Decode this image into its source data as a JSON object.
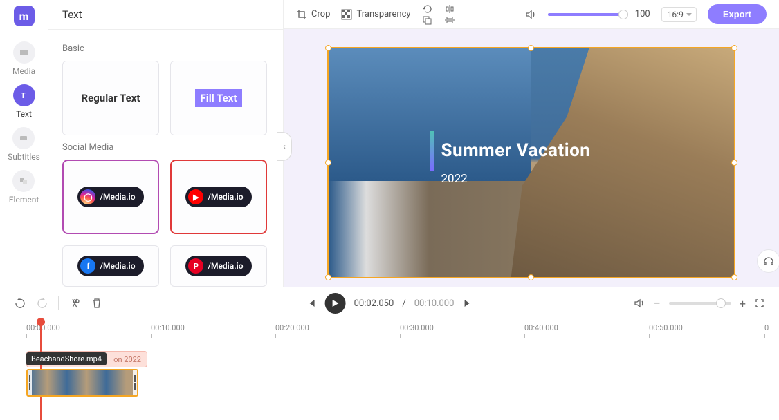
{
  "rail": {
    "items": [
      {
        "label": "Media"
      },
      {
        "label": "Text"
      },
      {
        "label": "Subtitles"
      },
      {
        "label": "Element"
      }
    ]
  },
  "panel": {
    "title": "Text",
    "section_basic": "Basic",
    "regular": "Regular Text",
    "fill": "Fill Text",
    "section_social": "Social Media",
    "social_handle": "/Media.io"
  },
  "toolbar": {
    "crop": "Crop",
    "transparency": "Transparency",
    "opacity_value": "100",
    "aspect": "16:9",
    "export": "Export"
  },
  "overlay": {
    "title": "Summer Vacation",
    "year": "2022"
  },
  "player": {
    "current": "00:02.050",
    "sep": " / ",
    "total": "00:10.000"
  },
  "timeline": {
    "marks": [
      "00:00.000",
      "00:10.000",
      "00:20.000",
      "00:30.000",
      "00:40.000",
      "00:50.000",
      "0"
    ],
    "text_clip_label": "on 2022",
    "tooltip": "BeachandShore.mp4"
  }
}
